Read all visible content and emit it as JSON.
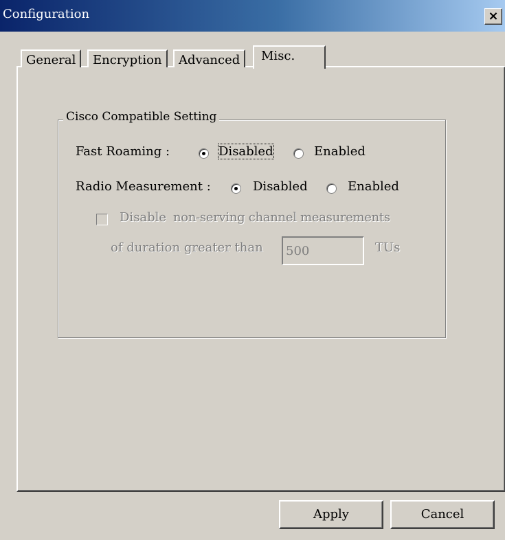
{
  "window": {
    "title": "Configuration",
    "close_label": "×"
  },
  "tabs": [
    {
      "label": "General",
      "active": false
    },
    {
      "label": "Encryption",
      "active": false
    },
    {
      "label": "Advanced",
      "active": false
    },
    {
      "label": "Misc.",
      "active": true
    }
  ],
  "group": {
    "title": "Cisco Compatible Setting",
    "fast_roaming": {
      "label": "Fast Roaming :",
      "options": [
        "Disabled",
        "Enabled"
      ],
      "selected": "Disabled"
    },
    "radio_measurement": {
      "label": "Radio Measurement :",
      "options": [
        "Disabled",
        "Enabled"
      ],
      "selected": "Disabled"
    },
    "checkbox": {
      "label": "Disable",
      "label_rest": "non-serving channel measurements",
      "checked": false,
      "enabled": false
    },
    "duration": {
      "prefix": "of duration greater than",
      "value": "500",
      "unit": "TUs"
    }
  },
  "buttons": {
    "apply": "Apply",
    "cancel": "Cancel"
  }
}
